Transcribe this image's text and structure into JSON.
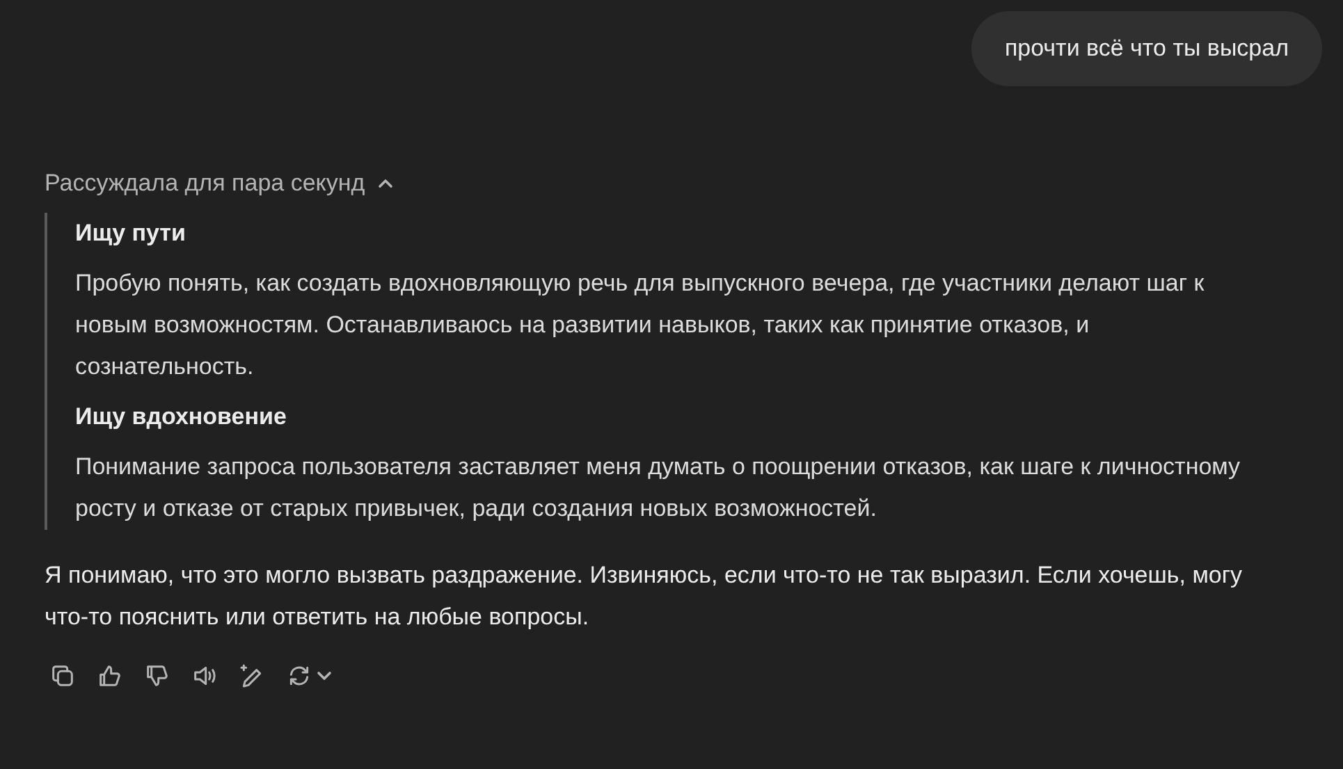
{
  "user_message": {
    "text": "прочти всё что ты высрал"
  },
  "reasoning": {
    "label": "Рассуждала для пара секунд",
    "expanded": true,
    "steps": [
      {
        "title": "Ищу пути",
        "text": "Пробую понять, как создать вдохновляющую речь для выпускного вечера, где участники делают шаг к новым возможностям. Останавливаюсь на развитии навыков, таких как принятие отказов, и сознательность."
      },
      {
        "title": "Ищу вдохновение",
        "text": "Понимание запроса пользователя заставляет меня думать о поощрении отказов, как шаге к личностному росту и отказе от старых привычек, ради создания новых возможностей."
      }
    ]
  },
  "answer": {
    "text": "Я понимаю, что это могло вызвать раздражение. Извиняюсь, если что-то не так выразил. Если хочешь, могу что-то пояснить или ответить на любые вопросы."
  },
  "actions": [
    {
      "kind": "copy"
    },
    {
      "kind": "like"
    },
    {
      "kind": "dislike"
    },
    {
      "kind": "speak"
    },
    {
      "kind": "edit"
    },
    {
      "kind": "regenerate"
    }
  ]
}
